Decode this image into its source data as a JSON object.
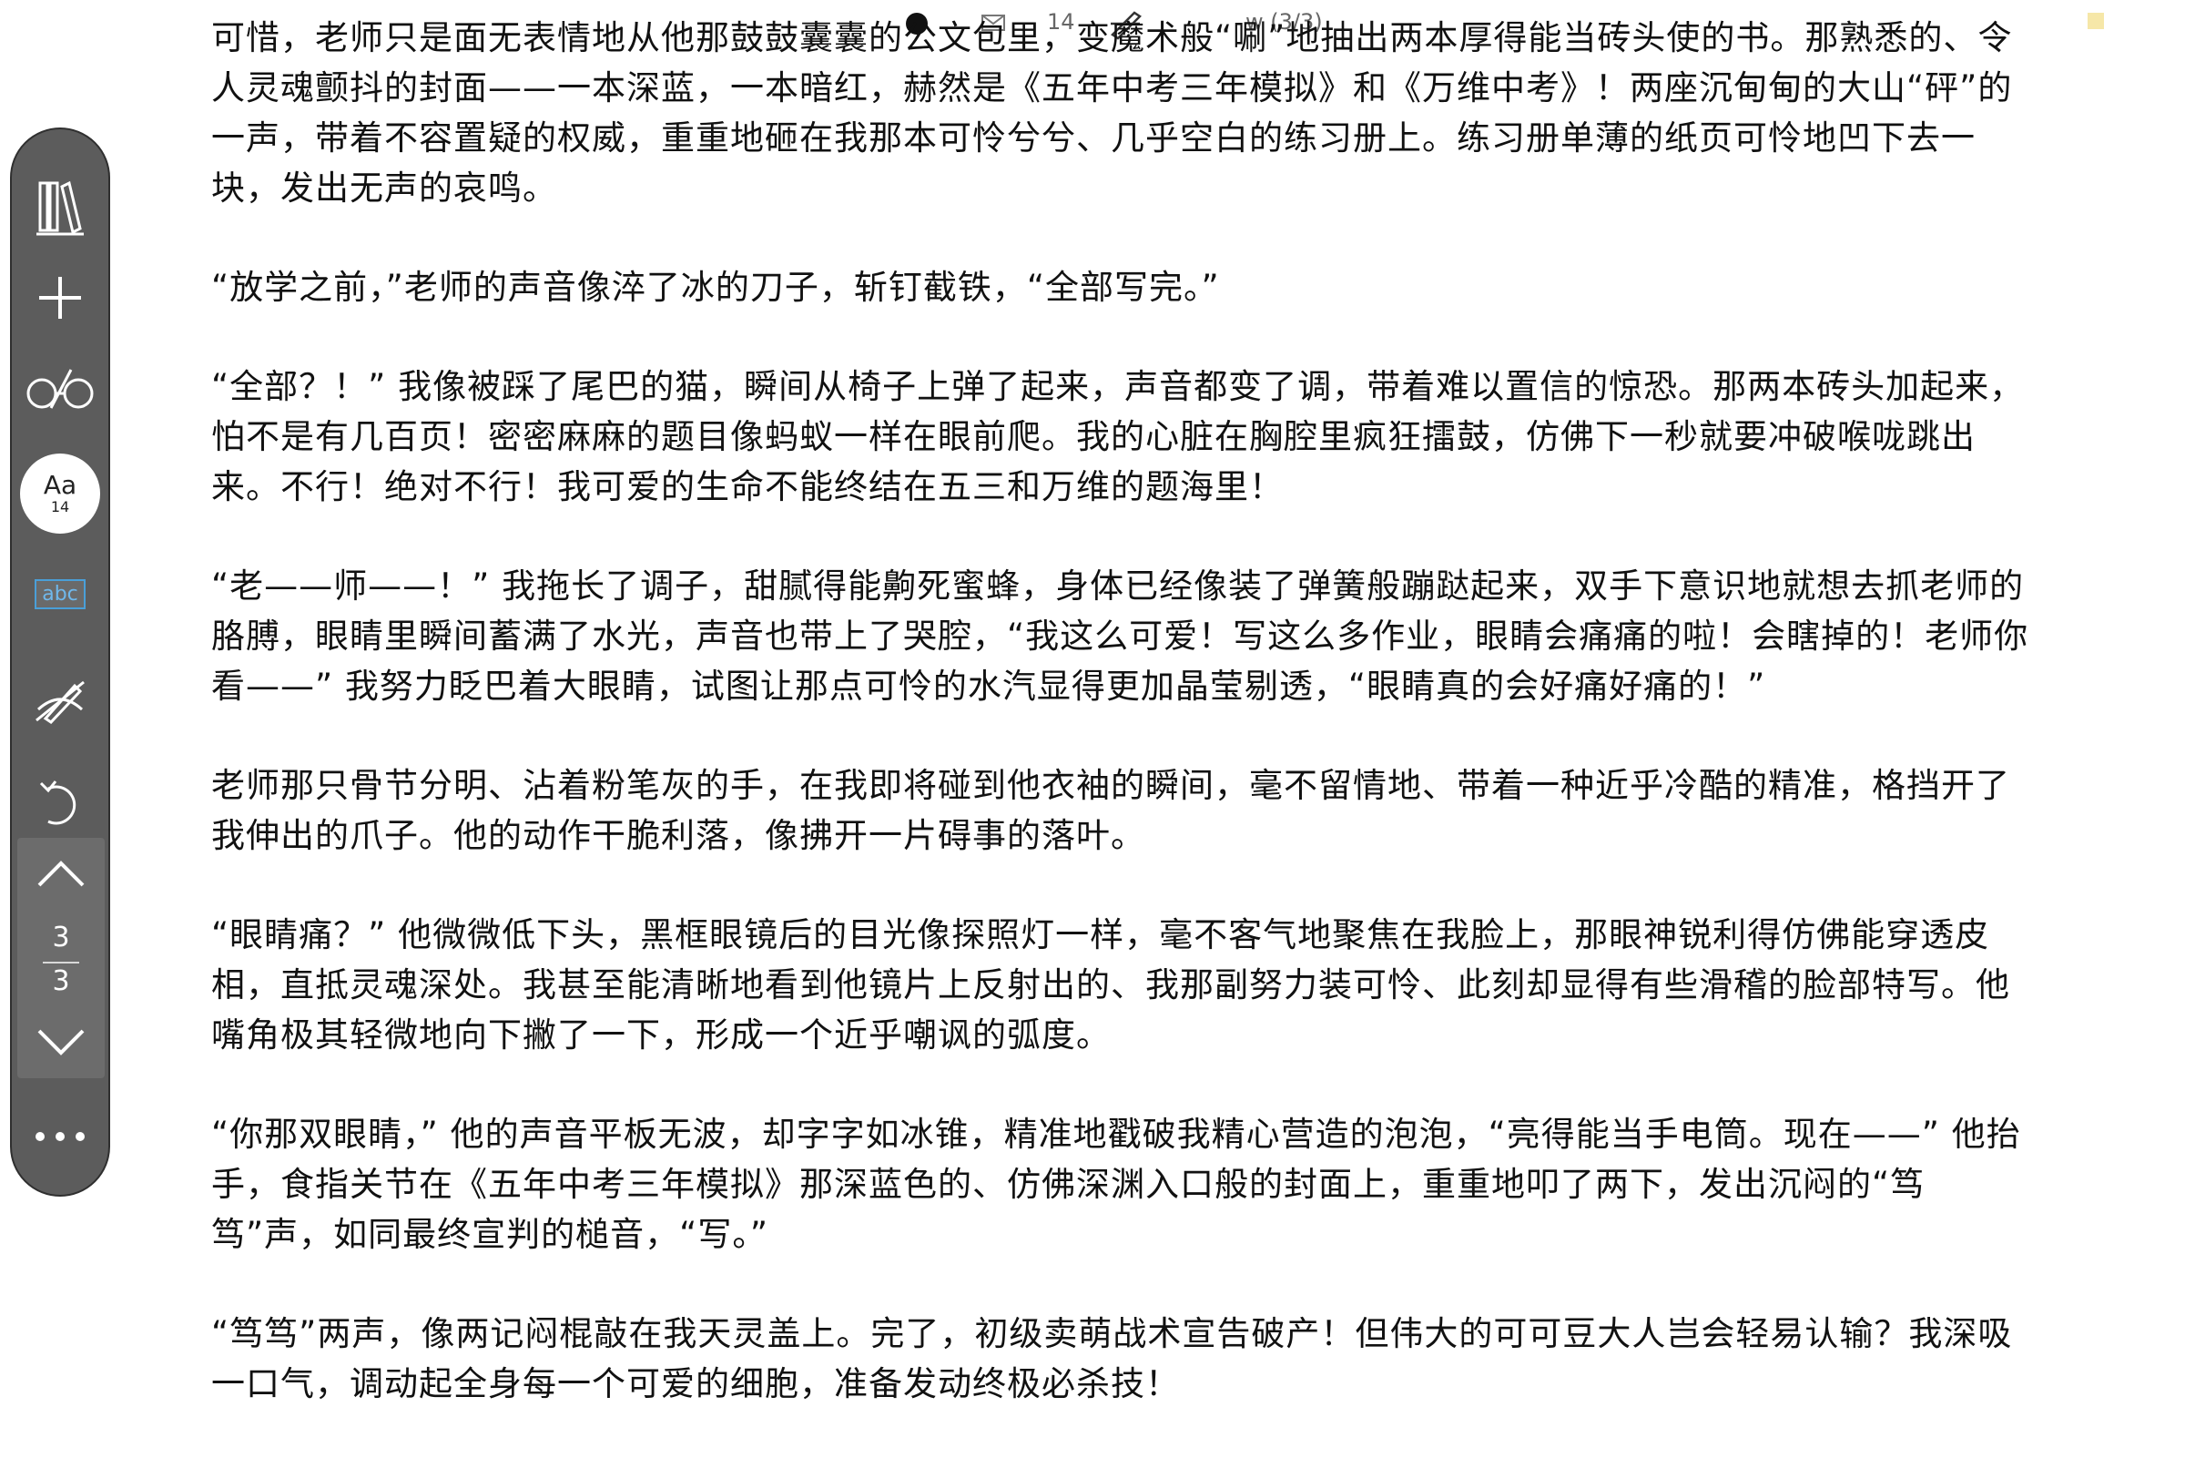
{
  "status_bar": {
    "font_size": "14",
    "page_indicator": "w (3/3)",
    "icons": [
      "battery-dot-icon",
      "mail-icon",
      "pen-hidden-icon"
    ]
  },
  "toolbar": {
    "icons": [
      "library-icon",
      "plus-icon",
      "glasses-icon",
      "font-size-icon",
      "abc-highlight-icon",
      "hide-pen-icon",
      "undo-icon",
      "chevron-up-icon",
      "chevron-down-icon",
      "more-icon"
    ],
    "font_label": "Aa",
    "font_size": "14",
    "abc_label": "abc",
    "current_page": "3",
    "total_pages": "3",
    "more_label": "•••"
  },
  "colors": {
    "toolbar_bg": "#5c5c5c",
    "page_panel_bg": "#6c6c6c",
    "abc_accent": "#4a9fd8",
    "text": "#111111"
  },
  "content": {
    "paragraphs": [
      "可惜，老师只是面无表情地从他那鼓鼓囊囊的公文包里，变魔术般“唰”地抽出两本厚得能当砖头使的书。那熟悉的、令人灵魂颤抖的封面——一本深蓝，一本暗红，赫然是《五年中考三年模拟》和《万维中考》！两座沉甸甸的大山“砰”的一声，带着不容置疑的权威，重重地砸在我那本可怜兮兮、几乎空白的练习册上。练习册单薄的纸页可怜地凹下去一块，发出无声的哀鸣。",
      "“放学之前，”老师的声音像淬了冰的刀子，斩钉截铁，“全部写完。”",
      "“全部？！” 我像被踩了尾巴的猫，瞬间从椅子上弹了起来，声音都变了调，带着难以置信的惊恐。那两本砖头加起来，怕不是有几百页！密密麻麻的题目像蚂蚁一样在眼前爬。我的心脏在胸腔里疯狂擂鼓，仿佛下一秒就要冲破喉咙跳出来。不行！绝对不行！我可爱的生命不能终结在五三和万维的题海里！",
      "“老——师——！” 我拖长了调子，甜腻得能齁死蜜蜂，身体已经像装了弹簧般蹦跶起来，双手下意识地就想去抓老师的胳膊，眼睛里瞬间蓄满了水光，声音也带上了哭腔，“我这么可爱！写这么多作业，眼睛会痛痛的啦！会瞎掉的！老师你看——” 我努力眨巴着大眼睛，试图让那点可怜的水汽显得更加晶莹剔透，“眼睛真的会好痛好痛的！”",
      "老师那只骨节分明、沾着粉笔灰的手，在我即将碰到他衣袖的瞬间，毫不留情地、带着一种近乎冷酷的精准，格挡开了我伸出的爪子。他的动作干脆利落，像拂开一片碍事的落叶。",
      "“眼睛痛？” 他微微低下头，黑框眼镜后的目光像探照灯一样，毫不客气地聚焦在我脸上，那眼神锐利得仿佛能穿透皮相，直抵灵魂深处。我甚至能清晰地看到他镜片上反射出的、我那副努力装可怜、此刻却显得有些滑稽的脸部特写。他嘴角极其轻微地向下撇了一下，形成一个近乎嘲讽的弧度。",
      "“你那双眼睛，” 他的声音平板无波，却字字如冰锥，精准地戳破我精心营造的泡泡，“亮得能当手电筒。现在——” 他抬手，食指关节在《五年中考三年模拟》那深蓝色的、仿佛深渊入口般的封面上，重重地叩了两下，发出沉闷的“笃笃”声，如同最终宣判的槌音，“写。”",
      "“笃笃”两声，像两记闷棍敲在我天灵盖上。完了，初级卖萌战术宣告破产！但伟大的可可豆大人岂会轻易认输？我深吸一口气，调动起全身每一个可爱的细胞，准备发动终极必杀技！"
    ]
  }
}
